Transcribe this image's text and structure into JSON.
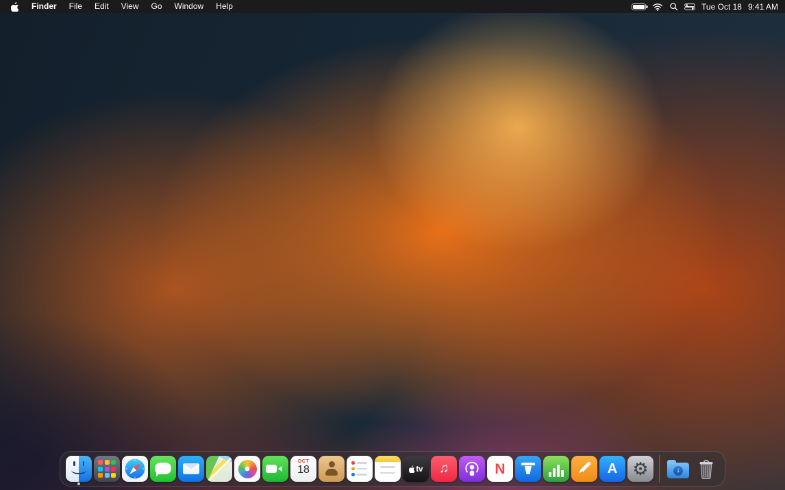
{
  "menu_bar": {
    "app_name": "Finder",
    "menus": [
      "File",
      "Edit",
      "View",
      "Go",
      "Window",
      "Help"
    ],
    "date": "Tue Oct 18",
    "time": "9:41 AM"
  },
  "dock": {
    "apps": [
      "Finder",
      "Launchpad",
      "Safari",
      "Messages",
      "Mail",
      "Maps",
      "Photos",
      "FaceTime",
      "Calendar",
      "Contacts",
      "Reminders",
      "Notes",
      "TV",
      "Music",
      "Podcasts",
      "News",
      "Keynote",
      "Numbers",
      "Pages",
      "App Store",
      "System Settings",
      "Downloads",
      "Trash"
    ],
    "calendar": {
      "month": "OCT",
      "day": "18"
    },
    "tv_label": "tv",
    "news_letter": "N",
    "app_store_letter": "A",
    "music_glyph": "♫",
    "settings_glyph": "⚙",
    "download_arrow": "↓"
  },
  "colors": {
    "wallpaper_orange": "#f07818",
    "wallpaper_navy": "#16222e",
    "menu_bar_bg": "#1c1c1f",
    "dock_bg": "rgba(48,48,52,0.5)",
    "calendar_red": "#e5382e"
  }
}
